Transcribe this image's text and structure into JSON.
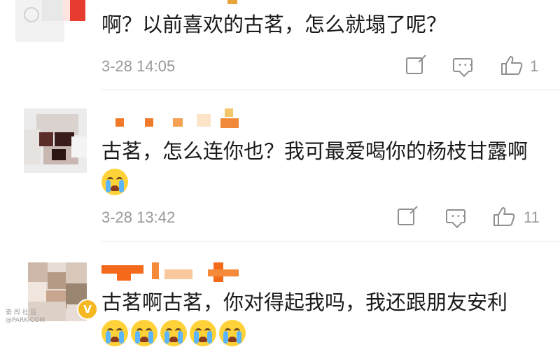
{
  "comments": [
    {
      "text": "啊？以前喜欢的古茗，怎么就塌了呢？",
      "time": "3-28 14:05",
      "likes": "1",
      "verified": false
    },
    {
      "text": "古茗，怎么连你也？我可最爱喝你的杨枝甘露啊",
      "time": "3-28 13:42",
      "likes": "11",
      "verified": false,
      "emoji_count": 1
    },
    {
      "text": "古茗啊古茗，你对得起我吗，我还跟朋友安利",
      "time": "",
      "likes": "",
      "verified": true,
      "emoji_count": 5
    }
  ],
  "icons": {
    "share": "share-icon",
    "comment": "comment-icon",
    "like": "thumbs-up-icon",
    "emoji": "crying-face-emoji"
  },
  "colors": {
    "meta_text": "#999999",
    "icon": "#8f8f8f",
    "verified_badge": "#f5b820"
  },
  "watermark": {
    "line1": "奋 闯 社 区",
    "line2": "@PARK·COM"
  }
}
